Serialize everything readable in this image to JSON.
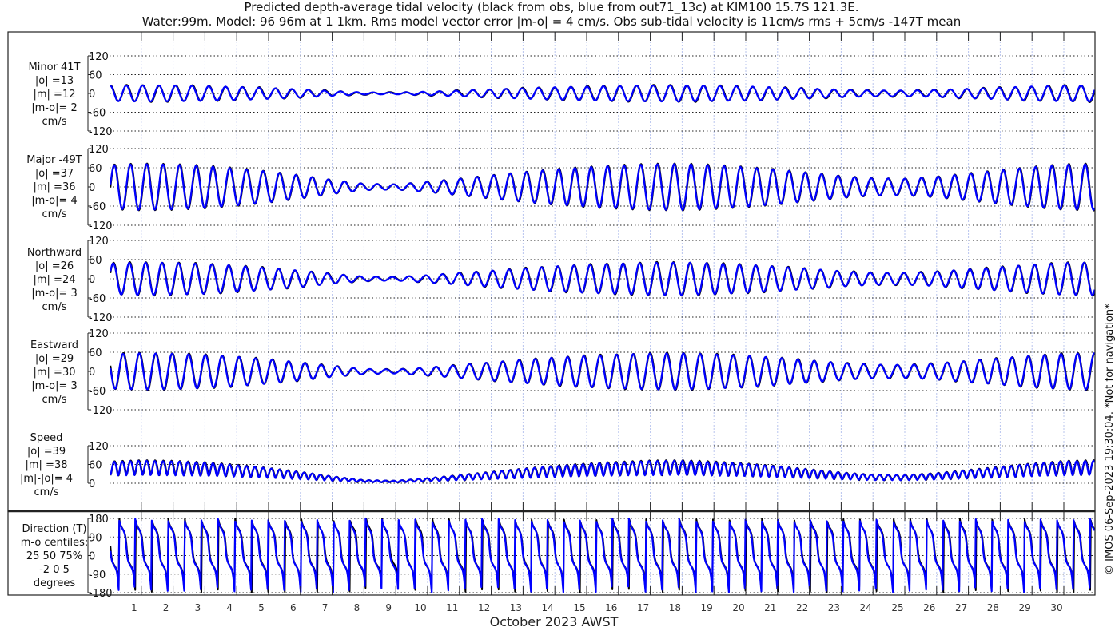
{
  "chart_data": {
    "type": "line",
    "title": "Predicted depth-average tidal velocity (black from obs, blue from out71_13c) at KIM100 15.7S 121.3E.",
    "subtitle": "Water:99m. Model: 96 96m at 1 1km. Rms model vector error |m-o| = 4 cm/s. Obs sub-tidal velocity is 11cm/s rms + 5cm/s -147T mean",
    "xlabel": "October 2023 AWST",
    "x_ticks": [
      "1",
      "2",
      "3",
      "4",
      "5",
      "6",
      "7",
      "8",
      "9",
      "10",
      "11",
      "12",
      "13",
      "14",
      "15",
      "16",
      "17",
      "18",
      "19",
      "20",
      "21",
      "22",
      "23",
      "24",
      "25",
      "26",
      "27",
      "28",
      "29",
      "30"
    ],
    "xlim_days": [
      0,
      31
    ],
    "tidal_period_days": 0.5175,
    "major_axis_deg": -49,
    "minor_axis_deg": 41,
    "major_amplitude_daily_cm_s": [
      68,
      72,
      70,
      66,
      58,
      48,
      36,
      22,
      10,
      8,
      16,
      26,
      36,
      46,
      55,
      62,
      67,
      71,
      72,
      68,
      62,
      54,
      44,
      34,
      27,
      26,
      32,
      42,
      52,
      62,
      70,
      72
    ],
    "minor_to_major_ratio": 0.36,
    "series": [
      {
        "name": "obs",
        "color": "#000000"
      },
      {
        "name": "model out71_13c",
        "color": "#0000ff"
      }
    ],
    "panels": [
      {
        "id": "minor",
        "labels": [
          "Minor 41T",
          "|o| =13",
          "|m| =12",
          "|m-o|= 2",
          "cm/s"
        ],
        "yticks": [
          "120",
          "60",
          "0",
          "-60",
          "-120"
        ],
        "ylim": [
          -120,
          120
        ]
      },
      {
        "id": "major",
        "labels": [
          "Major -49T",
          "|o| =37",
          "|m| =36",
          "|m-o|= 4",
          "cm/s"
        ],
        "yticks": [
          "120",
          "60",
          "0",
          "-60",
          "-120"
        ],
        "ylim": [
          -120,
          120
        ]
      },
      {
        "id": "north",
        "labels": [
          "Northward",
          "|o| =26",
          "|m| =24",
          "|m-o|= 3",
          "cm/s"
        ],
        "yticks": [
          "120",
          "60",
          "0",
          "-60",
          "-120"
        ],
        "ylim": [
          -120,
          120
        ]
      },
      {
        "id": "east",
        "labels": [
          "Eastward",
          "|o| =29",
          "|m| =30",
          "|m-o|= 3",
          "cm/s"
        ],
        "yticks": [
          "120",
          "60",
          "0",
          "-60",
          "-120"
        ],
        "ylim": [
          -120,
          120
        ]
      },
      {
        "id": "speed",
        "labels": [
          "Speed",
          "|o| =39",
          "|m| =38",
          "|m|-|o|= 4",
          "cm/s"
        ],
        "yticks": [
          "120",
          "60",
          "0"
        ],
        "ylim": [
          0,
          120
        ]
      },
      {
        "id": "direction",
        "labels": [
          "Direction (T)",
          "m-o centiles:",
          "25  50  75%",
          "-2  0  5",
          "degrees"
        ],
        "yticks": [
          "180",
          "90",
          "0",
          "-90",
          "-180"
        ],
        "ylim": [
          -180,
          180
        ]
      }
    ]
  },
  "footer": "© IMOS 06-Sep-2023 19:30:04. *Not for navigation*"
}
